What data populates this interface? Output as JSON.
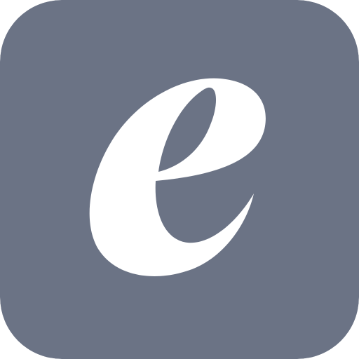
{
  "app_icon": {
    "icon_name": "letter-e-logo-icon",
    "glyph": "e",
    "background_color": "#6B7385",
    "glyph_color": "#FFFFFF"
  }
}
